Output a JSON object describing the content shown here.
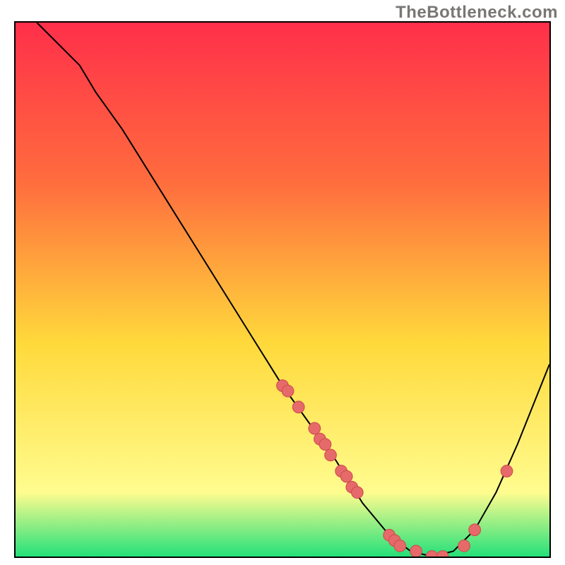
{
  "attribution": "TheBottleneck.com",
  "colors": {
    "gradient_top": "#ff2f4a",
    "gradient_mid_upper": "#ff6d3e",
    "gradient_mid": "#ffd93b",
    "gradient_lower": "#fffc8f",
    "gradient_bottom": "#24e07a",
    "curve_stroke": "#000000",
    "marker_fill": "#e66a6a",
    "marker_stroke": "#d04e4e"
  },
  "chart_data": {
    "type": "line",
    "title": "",
    "xlabel": "",
    "ylabel": "",
    "xlim": [
      0,
      100
    ],
    "ylim": [
      0,
      100
    ],
    "curve": [
      {
        "x": 4,
        "y": 100
      },
      {
        "x": 8,
        "y": 96
      },
      {
        "x": 12,
        "y": 92
      },
      {
        "x": 15,
        "y": 87
      },
      {
        "x": 20,
        "y": 80
      },
      {
        "x": 25,
        "y": 72
      },
      {
        "x": 30,
        "y": 64
      },
      {
        "x": 35,
        "y": 56
      },
      {
        "x": 40,
        "y": 48
      },
      {
        "x": 45,
        "y": 40
      },
      {
        "x": 50,
        "y": 32
      },
      {
        "x": 55,
        "y": 25
      },
      {
        "x": 60,
        "y": 18
      },
      {
        "x": 65,
        "y": 10
      },
      {
        "x": 70,
        "y": 4
      },
      {
        "x": 74,
        "y": 1
      },
      {
        "x": 78,
        "y": 0
      },
      {
        "x": 82,
        "y": 1
      },
      {
        "x": 86,
        "y": 5
      },
      {
        "x": 90,
        "y": 12
      },
      {
        "x": 94,
        "y": 21
      },
      {
        "x": 98,
        "y": 31
      },
      {
        "x": 100,
        "y": 36
      }
    ],
    "markers": [
      {
        "x": 50,
        "y": 32
      },
      {
        "x": 51,
        "y": 31
      },
      {
        "x": 53,
        "y": 28
      },
      {
        "x": 56,
        "y": 24
      },
      {
        "x": 57,
        "y": 22
      },
      {
        "x": 58,
        "y": 21
      },
      {
        "x": 59,
        "y": 19
      },
      {
        "x": 61,
        "y": 16
      },
      {
        "x": 62,
        "y": 15
      },
      {
        "x": 63,
        "y": 13
      },
      {
        "x": 64,
        "y": 12
      },
      {
        "x": 70,
        "y": 4
      },
      {
        "x": 71,
        "y": 3
      },
      {
        "x": 72,
        "y": 2
      },
      {
        "x": 75,
        "y": 1
      },
      {
        "x": 78,
        "y": 0
      },
      {
        "x": 80,
        "y": 0
      },
      {
        "x": 84,
        "y": 2
      },
      {
        "x": 86,
        "y": 5
      },
      {
        "x": 92,
        "y": 16
      }
    ]
  }
}
